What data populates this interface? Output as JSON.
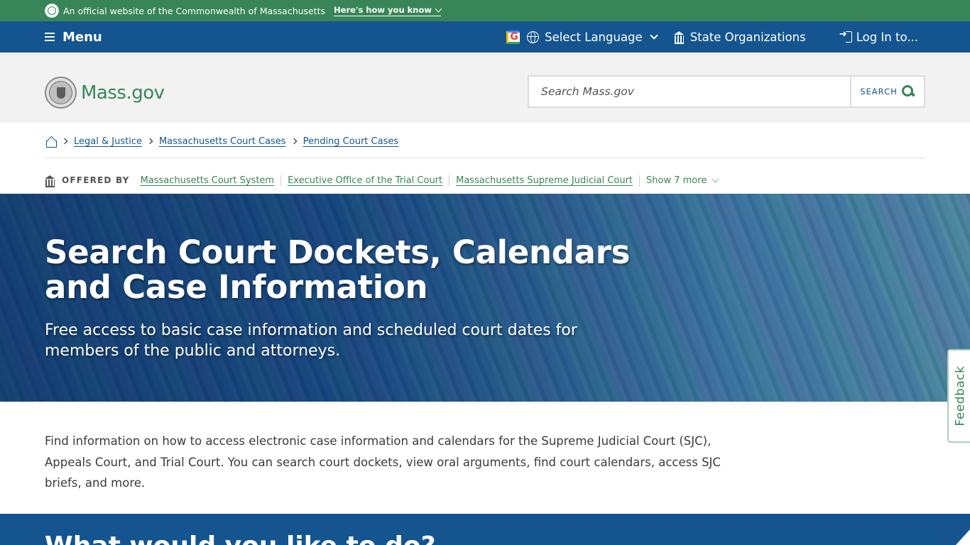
{
  "official_banner": {
    "text": "An official website of the Commonwealth of Massachusetts",
    "link": "Here's how you know"
  },
  "utility_nav": {
    "menu": "Menu",
    "language": "Select Language",
    "state_orgs": "State Organizations",
    "login": "Log In to..."
  },
  "header": {
    "logo": "Mass.gov",
    "search_placeholder": "Search Mass.gov",
    "search_button": "SEARCH"
  },
  "breadcrumb": [
    "Legal & Justice",
    "Massachusetts Court Cases",
    "Pending Court Cases"
  ],
  "offered_by": {
    "label": "OFFERED BY",
    "orgs": [
      "Massachusetts Court System",
      "Executive Office of the Trial Court",
      "Massachusetts Supreme Judicial Court"
    ],
    "show_more": "Show 7 more"
  },
  "hero": {
    "title": "Search Court Dockets, Calendars and Case Information",
    "subtitle": "Free access to basic case information and scheduled court dates for members of the public and attorneys."
  },
  "intro": "Find information on how to access electronic case information and calendars for the Supreme Judicial Court (SJC), Appeals Court, and Trial Court. You can search court dockets, view oral arguments, find court calendars, access SJC briefs, and more.",
  "section_heading": "What would you like to do?",
  "feedback": "Feedback",
  "colors": {
    "brand_green": "#388557",
    "brand_blue": "#14558f"
  }
}
